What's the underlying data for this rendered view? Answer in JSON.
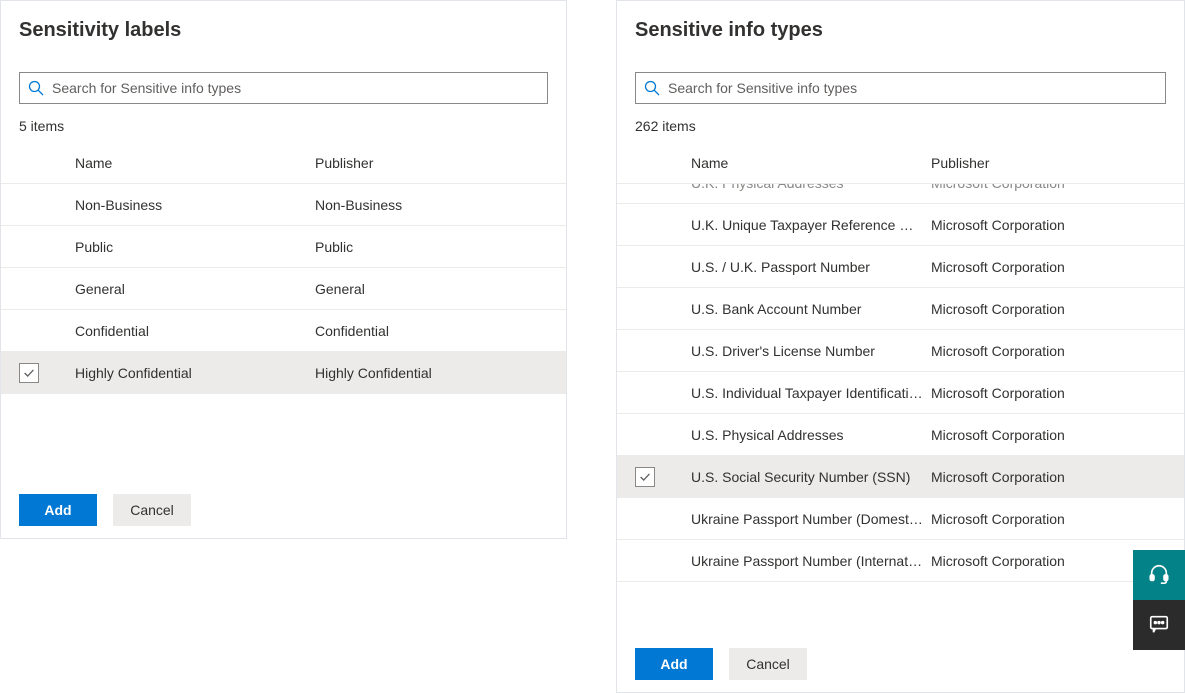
{
  "left": {
    "title": "Sensitivity labels",
    "search_placeholder": "Search for Sensitive info types",
    "count": "5 items",
    "columns": {
      "name": "Name",
      "publisher": "Publisher"
    },
    "rows": [
      {
        "name": "Non-Business",
        "publisher": "Non-Business",
        "selected": false
      },
      {
        "name": "Public",
        "publisher": "Public",
        "selected": false
      },
      {
        "name": "General",
        "publisher": "General",
        "selected": false
      },
      {
        "name": "Confidential",
        "publisher": "Confidential",
        "selected": false
      },
      {
        "name": "Highly Confidential",
        "publisher": "Highly Confidential",
        "selected": true
      }
    ],
    "add": "Add",
    "cancel": "Cancel"
  },
  "right": {
    "title": "Sensitive info types",
    "search_placeholder": "Search for Sensitive info types",
    "count": "262 items",
    "columns": {
      "name": "Name",
      "publisher": "Publisher"
    },
    "rows": [
      {
        "name": "U.K. Physical Addresses",
        "publisher": "Microsoft Corporation",
        "selected": false,
        "partial": true
      },
      {
        "name": "U.K. Unique Taxpayer Reference Number",
        "publisher": "Microsoft Corporation",
        "selected": false
      },
      {
        "name": "U.S. / U.K. Passport Number",
        "publisher": "Microsoft Corporation",
        "selected": false
      },
      {
        "name": "U.S. Bank Account Number",
        "publisher": "Microsoft Corporation",
        "selected": false
      },
      {
        "name": "U.S. Driver's License Number",
        "publisher": "Microsoft Corporation",
        "selected": false
      },
      {
        "name": "U.S. Individual Taxpayer Identification N…",
        "publisher": "Microsoft Corporation",
        "selected": false
      },
      {
        "name": "U.S. Physical Addresses",
        "publisher": "Microsoft Corporation",
        "selected": false
      },
      {
        "name": "U.S. Social Security Number (SSN)",
        "publisher": "Microsoft Corporation",
        "selected": true
      },
      {
        "name": "Ukraine Passport Number (Domestic)",
        "publisher": "Microsoft Corporation",
        "selected": false
      },
      {
        "name": "Ukraine Passport Number (International)",
        "publisher": "Microsoft Corporation",
        "selected": false
      }
    ],
    "add": "Add",
    "cancel": "Cancel"
  },
  "icons": {
    "help": "help-headset-icon",
    "feedback": "feedback-chat-icon"
  }
}
